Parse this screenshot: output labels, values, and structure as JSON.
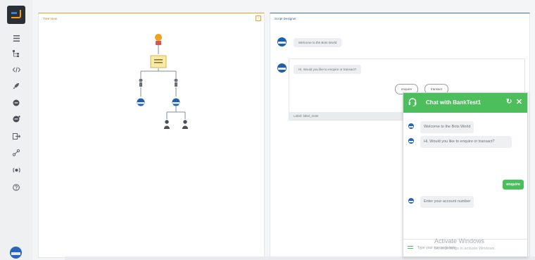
{
  "tree_view": {
    "title": "Tree View"
  },
  "script_designer": {
    "title": "Script Designer",
    "welcome_message": "Welcome to the Bots World",
    "question_message": "Hi, Would you like to enquire or transact?",
    "options": [
      "enquire",
      "transact"
    ],
    "label_row": "Label: label_enter"
  },
  "chat": {
    "title": "Chat with BankTest1",
    "refresh_icon": "refresh-icon",
    "close_icon": "close-icon",
    "messages": [
      {
        "from": "bot",
        "text": "Welcome to the Bots World"
      },
      {
        "from": "bot",
        "text": "Hi, Would you like to enquire or transact?"
      },
      {
        "from": "user",
        "text": "enquire"
      },
      {
        "from": "bot",
        "text": "Enter your account number"
      }
    ],
    "input_placeholder": "Type your message here",
    "accent_color": "#4cbf5c"
  },
  "watermark": {
    "title": "Activate Windows",
    "subtitle": "Go to Settings to activate Windows."
  },
  "sidebar": {
    "icons": [
      "grid-icon",
      "tree-icon",
      "code-icon",
      "rocket-icon",
      "chat-icon",
      "chat-alt-icon",
      "export-icon",
      "share-icon",
      "broadcast-icon",
      "help-icon"
    ]
  }
}
